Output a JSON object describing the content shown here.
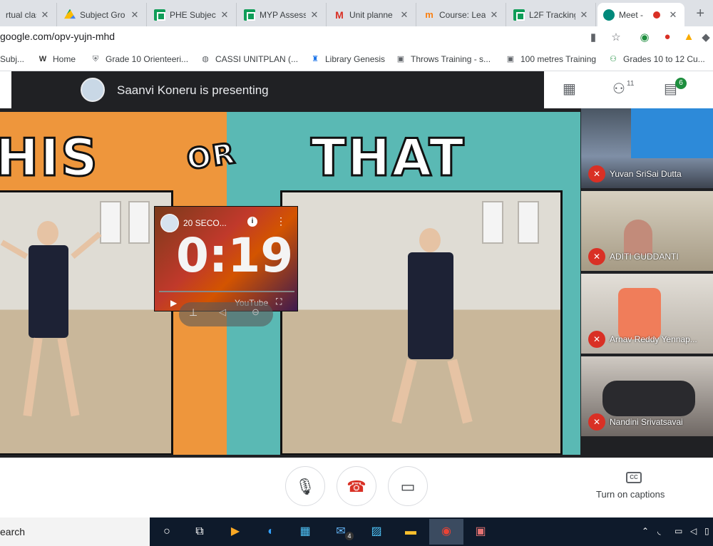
{
  "browser": {
    "tabs": [
      {
        "label": "rtual class",
        "icon": "virtual-class-icon"
      },
      {
        "label": "Subject Gro",
        "icon": "drive-icon"
      },
      {
        "label": "PHE Subject",
        "icon": "sheets-icon"
      },
      {
        "label": "MYP Assess",
        "icon": "sheets-icon"
      },
      {
        "label": "Unit planne",
        "icon": "gmail-icon"
      },
      {
        "label": "Course: Lea",
        "icon": "moodle-icon"
      },
      {
        "label": "L2F Tracking",
        "icon": "sheets-icon"
      },
      {
        "label": "Meet -",
        "icon": "meet-icon",
        "active": true
      }
    ],
    "tab_close": "✕",
    "new_tab": "+",
    "url": "google.com/opv-yujn-mhd",
    "bookmarks": [
      {
        "label": "Subj...",
        "icon": "folder-icon"
      },
      {
        "label": "Home",
        "icon": "home-logo-icon"
      },
      {
        "label": "Grade 10 Orienteeri...",
        "icon": "school-crest-icon"
      },
      {
        "label": "CASSI UNITPLAN (...",
        "icon": "globe-icon"
      },
      {
        "label": "Library Genesis",
        "icon": "library-icon"
      },
      {
        "label": "Throws Training - s...",
        "icon": "throws-icon"
      },
      {
        "label": "100 metres Training",
        "icon": "throws-icon"
      },
      {
        "label": "Grades 10 to 12 Cu...",
        "icon": "people-icon"
      }
    ]
  },
  "meet": {
    "presenter_text": "Saanvi Koneru is presenting",
    "participants_count": "11",
    "chat_badge": "6",
    "slide": {
      "left_word": "HIS",
      "middle_word": "OR",
      "right_word": "THAT"
    },
    "timer": {
      "title": "20 SECO...",
      "time": "0:19",
      "brand": "YouTube"
    },
    "participants": [
      {
        "name": "Yuvan SriSai Dutta",
        "bg": "#7f8fa6"
      },
      {
        "name": "ADITI GUDDANTI",
        "bg": "#b7ac95"
      },
      {
        "name": "Arnav Reddy Yennap...",
        "bg": "#c9c3b8"
      },
      {
        "name": "Nandini Srivatsavai",
        "bg": "#8a8380"
      }
    ],
    "captions_label": "Turn on captions",
    "cc_label": "CC"
  },
  "taskbar": {
    "search_text": "earch",
    "chrome_count": "4"
  },
  "colors": {
    "orange": "#ee963c",
    "teal": "#5ab9b4",
    "hangup": "#d93025"
  }
}
